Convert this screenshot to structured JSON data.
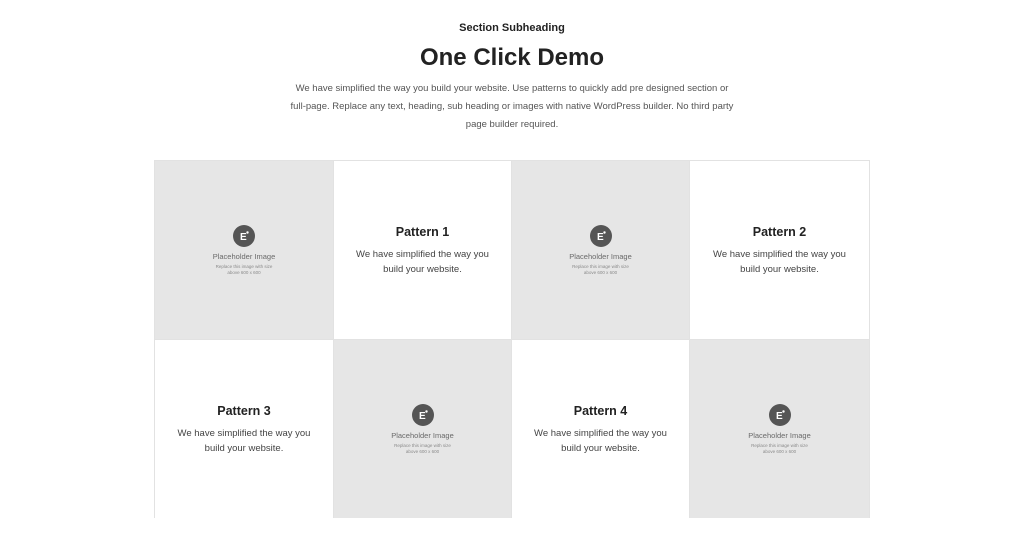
{
  "section": {
    "subheading": "Section Subheading",
    "title": "One Click Demo",
    "description": "We have simplified the way you build your website. Use patterns to quickly add pre designed section or full-page. Replace any text, heading, sub heading or images with native WordPress builder. No third party page builder required."
  },
  "placeholder": {
    "icon": "elementor-logo-icon",
    "title": "Placeholder Image",
    "note": "Replace this image with size above 600 x 600"
  },
  "patterns": [
    {
      "title": "Pattern 1",
      "text": "We have simplified the way you build your website."
    },
    {
      "title": "Pattern 2",
      "text": "We have simplified the way you build your website."
    },
    {
      "title": "Pattern 3",
      "text": "We have simplified the way you build your website."
    },
    {
      "title": "Pattern 4",
      "text": "We have simplified the way you build your website."
    }
  ],
  "colors": {
    "placeholder_bg": "#e6e6e6",
    "border": "#e2e2e2",
    "icon_bg": "#555555",
    "text_dark": "#222222"
  }
}
